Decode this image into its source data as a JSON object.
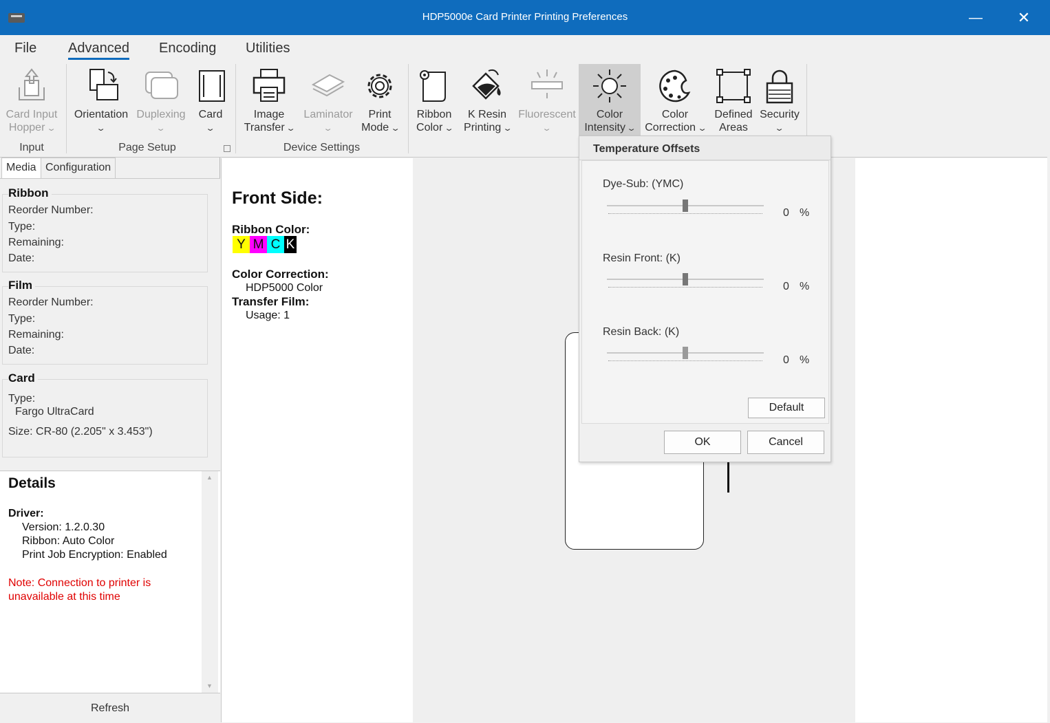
{
  "window": {
    "title": "HDP5000e Card Printer Printing Preferences"
  },
  "menu": {
    "tabs": [
      "File",
      "Advanced",
      "Encoding",
      "Utilities"
    ]
  },
  "ribbon": {
    "buttons": [
      {
        "line1": "Card Input",
        "line2": "Hopper"
      },
      {
        "line1": "Orientation",
        "line2": ""
      },
      {
        "line1": "Duplexing",
        "line2": ""
      },
      {
        "line1": "Card",
        "line2": ""
      },
      {
        "line1": "Image",
        "line2": "Transfer"
      },
      {
        "line1": "Laminator",
        "line2": ""
      },
      {
        "line1": "Print",
        "line2": "Mode"
      },
      {
        "line1": "Ribbon",
        "line2": "Color"
      },
      {
        "line1": "K Resin",
        "line2": "Printing"
      },
      {
        "line1": "Fluorescent",
        "line2": ""
      },
      {
        "line1": "Color",
        "line2": "Intensity"
      },
      {
        "line1": "Color",
        "line2": "Correction"
      },
      {
        "line1": "Defined",
        "line2": "Areas"
      },
      {
        "line1": "Security",
        "line2": ""
      }
    ],
    "groups": [
      "Input",
      "Page Setup",
      "Device Settings"
    ]
  },
  "left_panel": {
    "tabs": [
      "Media",
      "Configuration"
    ],
    "ribbon_group": {
      "title": "Ribbon",
      "lines": [
        "Reorder Number:",
        "Type:",
        "Remaining:",
        "Date:"
      ]
    },
    "film_group": {
      "title": "Film",
      "lines": [
        "Reorder Number:",
        "Type:",
        "Remaining:",
        "Date:"
      ]
    },
    "card_group": {
      "title": "Card",
      "type_label": "Type:",
      "type_value": "Fargo UltraCard",
      "size": "Size: CR-80 (2.205\" x 3.453\")"
    },
    "details": {
      "title": "Details",
      "driver_label": "Driver:",
      "lines": [
        "Version: 1.2.0.30",
        "Ribbon: Auto Color",
        "Print Job Encryption: Enabled"
      ],
      "note": "Note: Connection to printer is unavailable at this time"
    },
    "refresh_label": "Refresh"
  },
  "preview": {
    "heading": "Front Side:",
    "ribbon_color_label": "Ribbon Color:",
    "swatches": [
      {
        "letter": "Y",
        "color": "#ffff00"
      },
      {
        "letter": "M",
        "color": "#ff00ff"
      },
      {
        "letter": "C",
        "color": "#00ffff"
      },
      {
        "letter": "K",
        "color": "#000000"
      }
    ],
    "color_correction_label": "Color Correction:",
    "color_correction_value": "HDP5000 Color",
    "transfer_film_label": "Transfer Film:",
    "transfer_film_value": "Usage: 1"
  },
  "popup": {
    "title": "Temperature Offsets",
    "sliders": [
      {
        "label": "Dye-Sub: (YMC)",
        "value": "0",
        "unit": "%"
      },
      {
        "label": "Resin Front: (K)",
        "value": "0",
        "unit": "%"
      },
      {
        "label": "Resin Back: (K)",
        "value": "0",
        "unit": "%"
      }
    ],
    "default_label": "Default",
    "ok_label": "OK",
    "cancel_label": "Cancel"
  },
  "colors": {
    "accent": "#0f6cbd",
    "note": "#e00000"
  }
}
